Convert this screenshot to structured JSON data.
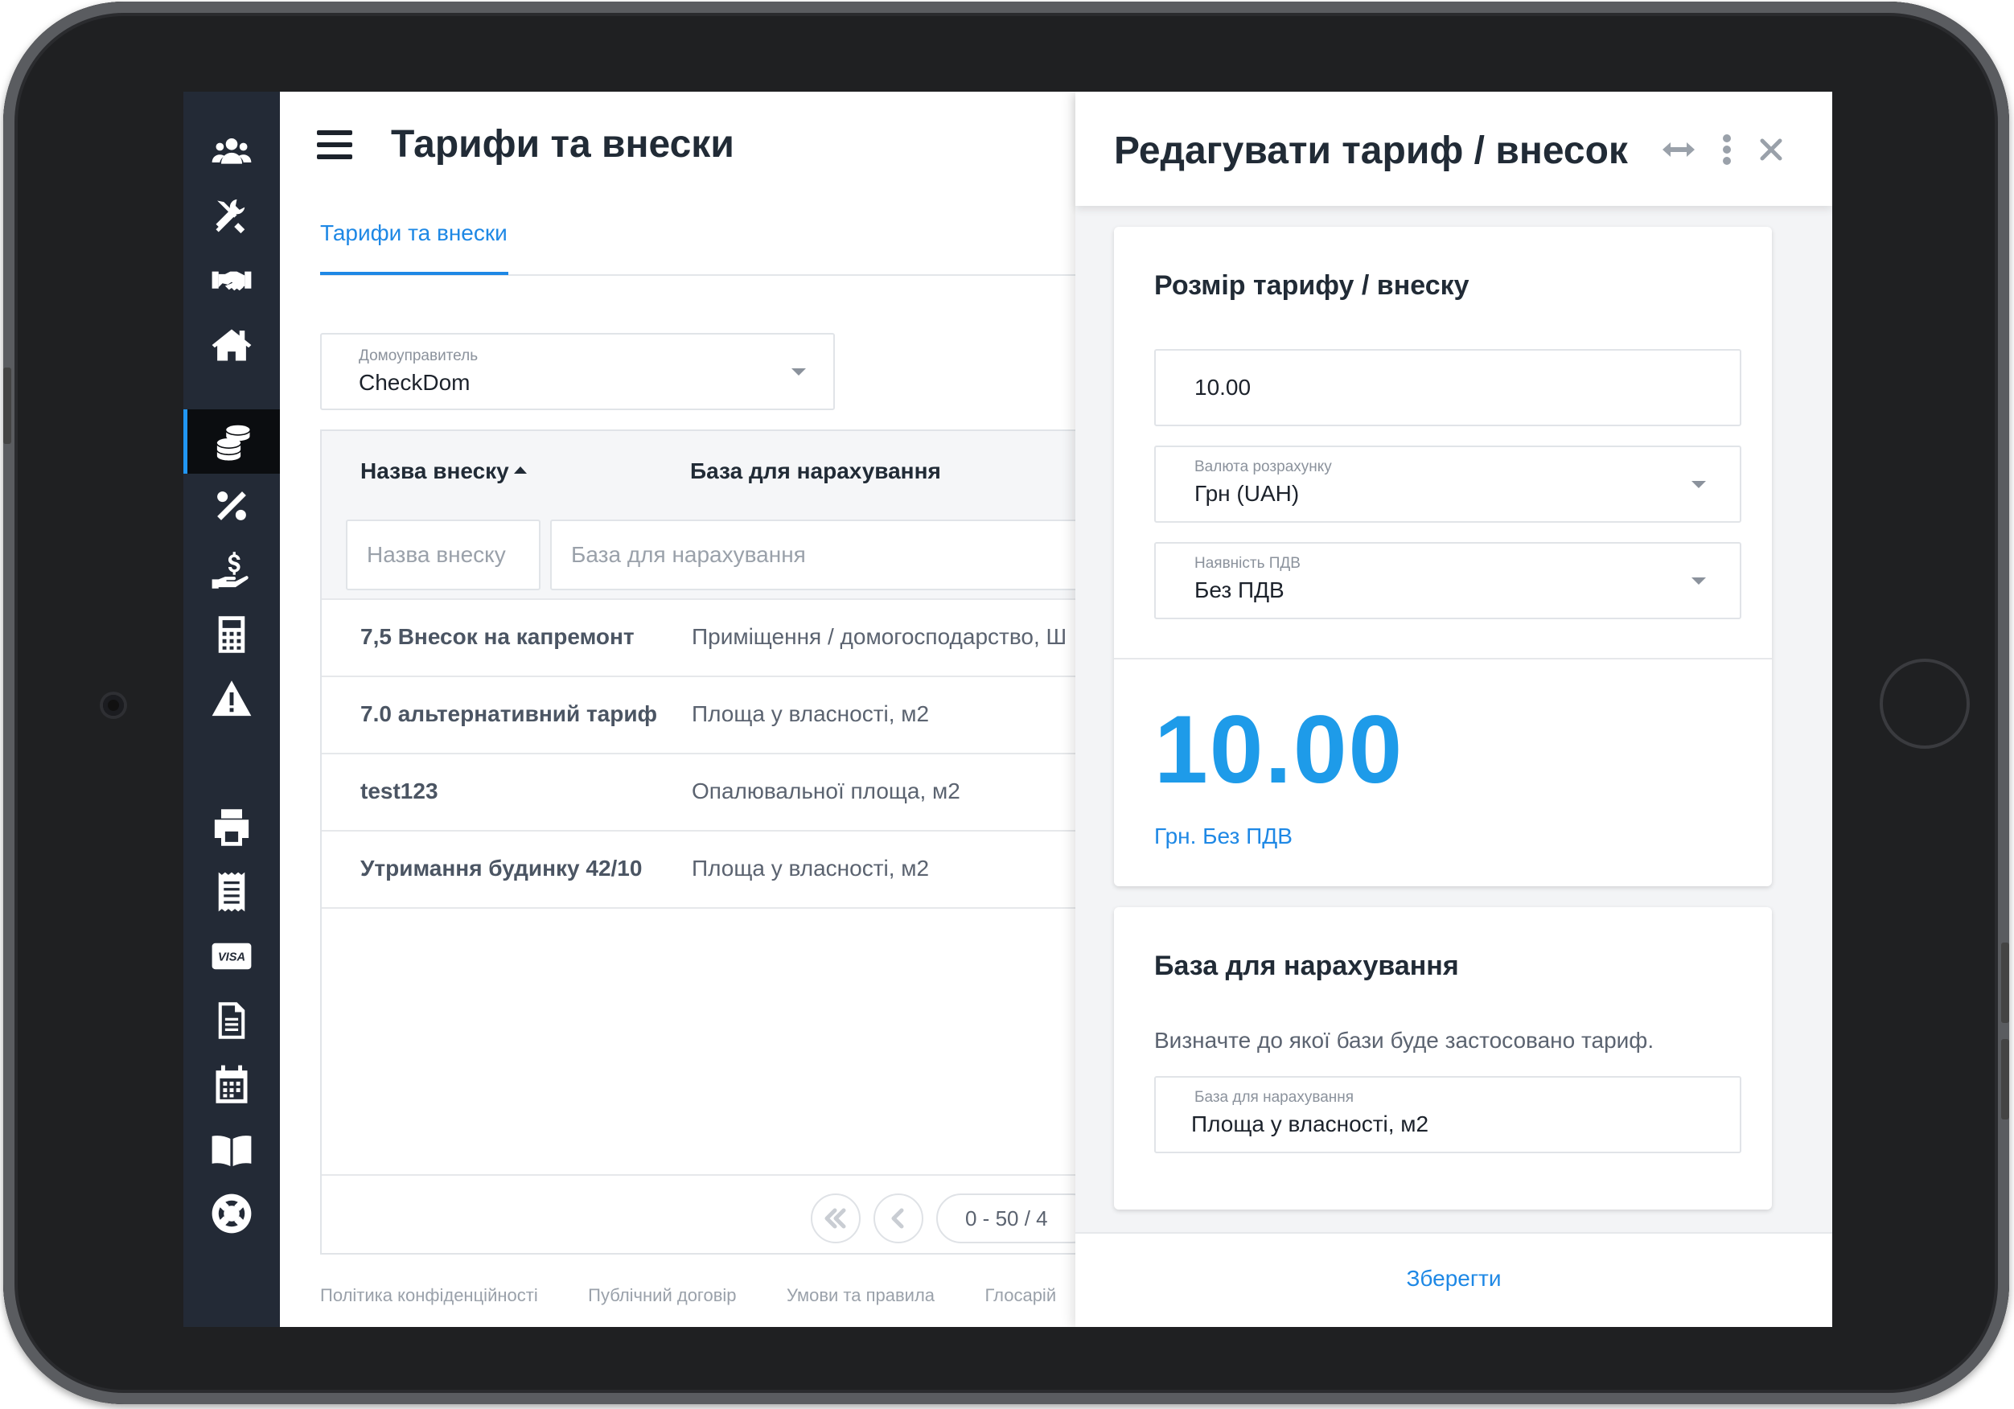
{
  "sidebar": {
    "items": [
      {
        "icon": "users-icon"
      },
      {
        "icon": "tools-icon"
      },
      {
        "icon": "handshake-icon"
      },
      {
        "icon": "home-icon"
      },
      {
        "icon": "coins-icon",
        "active": true
      },
      {
        "icon": "percent-icon"
      },
      {
        "icon": "hand-dollar-icon"
      },
      {
        "icon": "calculator-icon"
      },
      {
        "icon": "warning-icon"
      },
      {
        "icon": "printer-icon"
      },
      {
        "icon": "receipt-icon"
      },
      {
        "icon": "visa-card-icon"
      },
      {
        "icon": "document-icon"
      },
      {
        "icon": "calendar-icon"
      },
      {
        "icon": "book-icon"
      },
      {
        "icon": "lifebuoy-icon"
      }
    ],
    "visa_text": "VISA"
  },
  "main": {
    "title": "Тарифи та внески",
    "tab": "Тарифи та внески",
    "manager_select": {
      "label": "Домоуправитель",
      "value": "CheckDom"
    },
    "table": {
      "columns": [
        "Назва внеску",
        "База для нарахування"
      ],
      "filter_placeholders": [
        "Назва внеску",
        "База для нарахування"
      ],
      "rows": [
        {
          "name": "7,5 Внесок на капремонт",
          "base": "Приміщення / домогосподарство, Ш"
        },
        {
          "name": "7.0 альтернативний тариф",
          "base": "Площа у власності, м2"
        },
        {
          "name": "test123",
          "base": "Опалювальної площа, м2"
        },
        {
          "name": "Утримання будинку 42/10",
          "base": "Площа у власності, м2"
        }
      ],
      "pagination": "0 - 50 / 4"
    },
    "footer_links": [
      "Політика конфіденційності",
      "Публічний договір",
      "Умови та правила",
      "Глосарій"
    ]
  },
  "panel": {
    "title": "Редагувати тариф / внесок",
    "card1": {
      "title": "Розмір тарифу / внеску",
      "amount": "10.00",
      "currency": {
        "label": "Валюта розрахунку",
        "value": "Грн (UAH)"
      },
      "vat": {
        "label": "Наявність ПДВ",
        "value": "Без ПДВ"
      },
      "big_amount": "10.00",
      "summary": "Грн. Без ПДВ"
    },
    "card2": {
      "title": "База для нарахування",
      "description": "Визначте до якої бази буде застосовано тариф.",
      "field": {
        "label": "База для нарахування",
        "value": "Площа у власності, м2"
      }
    },
    "save_label": "Зберегти"
  },
  "colors": {
    "accent": "#1e88e5",
    "sidebar_bg": "#232a36",
    "big_amount": "#1e9be9"
  }
}
